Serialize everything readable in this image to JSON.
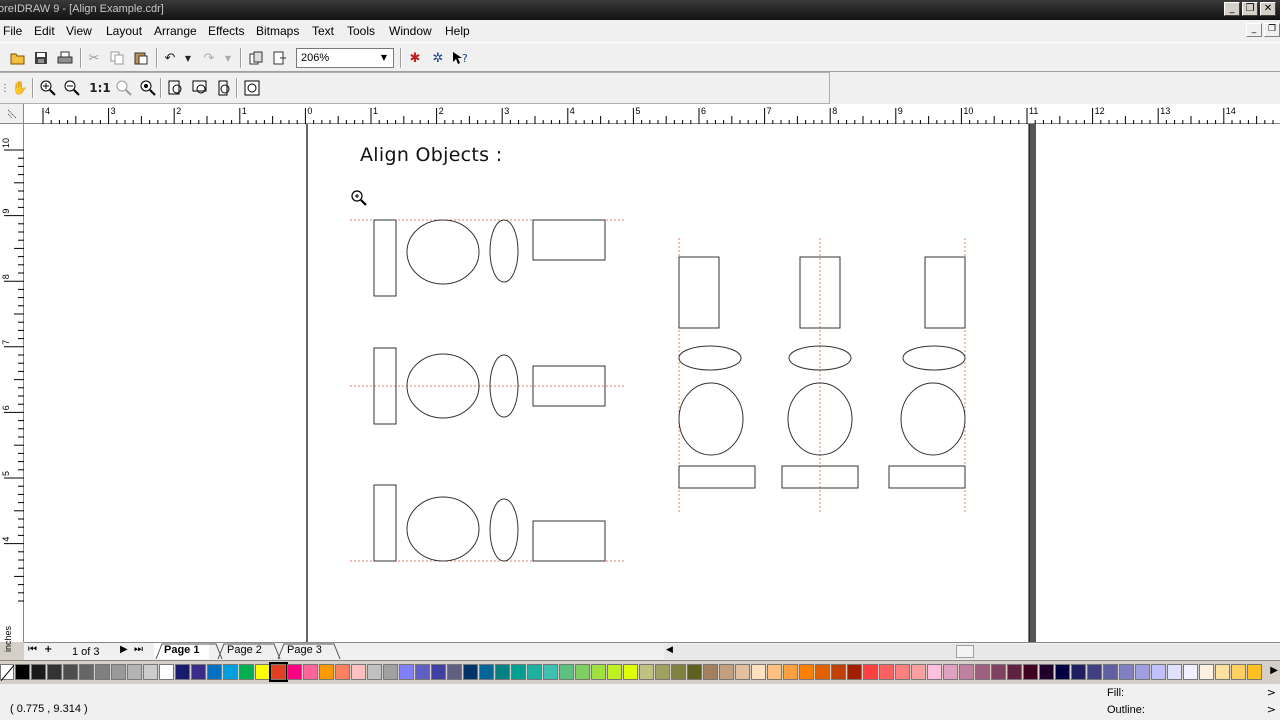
{
  "window": {
    "title": "oreIDRAW 9 - [Align Example.cdr]",
    "minimize": "_",
    "restore": "❐",
    "close": "✕"
  },
  "menu": [
    "File",
    "Edit",
    "View",
    "Layout",
    "Arrange",
    "Effects",
    "Bitmaps",
    "Text",
    "Tools",
    "Window",
    "Help"
  ],
  "toolbar": {
    "zoom_value": "206%"
  },
  "ruler": {
    "h_ticks": [
      "4",
      "3",
      "2",
      "1",
      "0",
      "1",
      "2",
      "3",
      "4",
      "5",
      "6",
      "7",
      "8",
      "9",
      "10",
      "11",
      "12",
      "13",
      "14"
    ],
    "v_ticks": [
      "10",
      "9",
      "8",
      "7",
      "6",
      "5",
      "4"
    ],
    "unit_label": "inches"
  },
  "document": {
    "heading": "Align Objects :"
  },
  "pagenav": {
    "page_count": "1 of 3",
    "tabs": [
      "Page 1",
      "Page 2",
      "Page 3"
    ],
    "active_tab": "Page 1"
  },
  "palette": {
    "selected_color": "#e04020",
    "colors": [
      "#000000",
      "#1a1a1a",
      "#333333",
      "#4d4d4d",
      "#666666",
      "#808080",
      "#999999",
      "#b3b3b3",
      "#cccccc",
      "#ffffff",
      "#1a1a6e",
      "#3a2a8a",
      "#0070c0",
      "#00a0e0",
      "#00b050",
      "#ffff00",
      "#e04020",
      "#ff0080",
      "#ff6699",
      "#ff9900",
      "#ff8060",
      "#ffc0c0",
      "#c0c0c0",
      "#a0a0a0",
      "#8080ff",
      "#6060c0",
      "#4040a0",
      "#606080",
      "#003366",
      "#006699",
      "#008080",
      "#00a090",
      "#20b0a0",
      "#40c0b0",
      "#60c080",
      "#80d060",
      "#a0e040",
      "#c0f020",
      "#e0ff00",
      "#c0c080",
      "#a0a060",
      "#808040",
      "#606020",
      "#a08060",
      "#c0a080",
      "#e0c0a0",
      "#ffe0c0",
      "#ffc080",
      "#ffa040",
      "#ff8000",
      "#e06000",
      "#c04000",
      "#a02000",
      "#ff4040",
      "#ff6060",
      "#ff8080",
      "#ffa0a0",
      "#ffc0e0",
      "#e0a0c0",
      "#c080a0",
      "#a06080",
      "#804060",
      "#602040",
      "#400020",
      "#20002a",
      "#000040",
      "#202060",
      "#404080",
      "#6060a0",
      "#8080c0",
      "#a0a0e0",
      "#c0c0ff",
      "#e0e0ff",
      "#f0f0ff",
      "#fff0e0",
      "#ffe0a0",
      "#ffd060",
      "#ffc020"
    ]
  },
  "status": {
    "coords": "( 0.775 , 9.314 )",
    "fill_label": "Fill:",
    "outline_label": "Outline:"
  }
}
